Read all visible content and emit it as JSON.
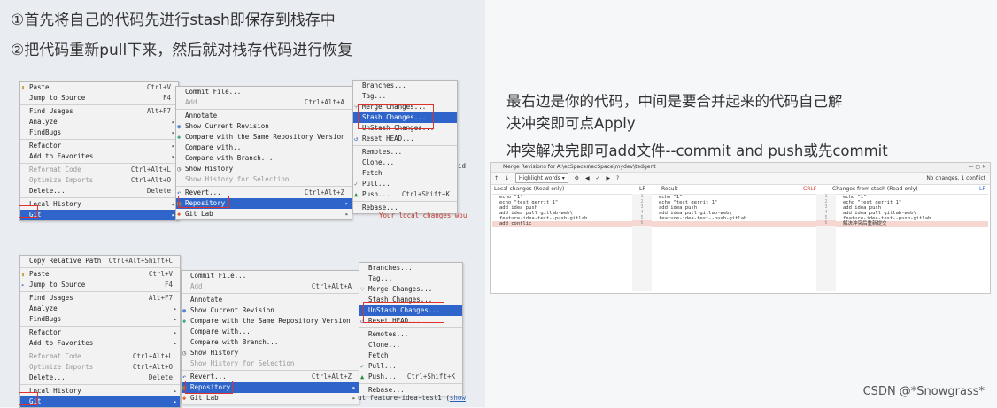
{
  "headings": {
    "step1": "①首先将自己的代码先进行stash即保存到栈存中",
    "step2": "②把代码重新pull下来，然后就对栈存代码进行恢复"
  },
  "notes": {
    "line1": "最右边是你的代码，中间是要合并起来的代码自己解",
    "line2": "决冲突即可点Apply",
    "line3": "冲突解决完即可add文件--commit and push或先commit"
  },
  "top_screenshot": {
    "menu1": {
      "items": [
        {
          "label": "Paste",
          "shortcut": "Ctrl+V"
        },
        {
          "label": "Jump to Source",
          "shortcut": "F4"
        },
        {
          "label": "Find Usages",
          "shortcut": "Alt+F7"
        },
        {
          "label": "Analyze",
          "shortcut": ""
        },
        {
          "label": "FindBugs",
          "shortcut": ""
        },
        {
          "label": "Refactor",
          "shortcut": ""
        },
        {
          "label": "Add to Favorites",
          "shortcut": ""
        },
        {
          "label": "Reformat Code",
          "shortcut": "Ctrl+Alt+L"
        },
        {
          "label": "Optimize Imports",
          "shortcut": "Ctrl+Alt+O"
        },
        {
          "label": "Delete...",
          "shortcut": "Delete"
        },
        {
          "label": "Local History",
          "shortcut": ""
        },
        {
          "label": "Git",
          "shortcut": ""
        }
      ]
    },
    "menu2": {
      "items": [
        {
          "label": "Commit File...",
          "shortcut": ""
        },
        {
          "label": "Add",
          "shortcut": "Ctrl+Alt+A"
        },
        {
          "label": "Annotate",
          "shortcut": ""
        },
        {
          "label": "Show Current Revision",
          "shortcut": ""
        },
        {
          "label": "Compare with the Same Repository Version",
          "shortcut": ""
        },
        {
          "label": "Compare with...",
          "shortcut": ""
        },
        {
          "label": "Compare with Branch...",
          "shortcut": ""
        },
        {
          "label": "Show History",
          "shortcut": ""
        },
        {
          "label": "Show History for Selection",
          "shortcut": ""
        },
        {
          "label": "Revert...",
          "shortcut": "Ctrl+Alt+Z"
        },
        {
          "label": "Repository",
          "shortcut": ""
        },
        {
          "label": "Git Lab",
          "shortcut": ""
        }
      ]
    },
    "menu3": {
      "items": [
        {
          "label": "Branches...",
          "shortcut": ""
        },
        {
          "label": "Tag...",
          "shortcut": ""
        },
        {
          "label": "Merge Changes...",
          "shortcut": ""
        },
        {
          "label": "Stash Changes...",
          "shortcut": ""
        },
        {
          "label": "UnStash Changes...",
          "shortcut": ""
        },
        {
          "label": "Reset HEAD...",
          "shortcut": ""
        },
        {
          "label": "Remotes...",
          "shortcut": ""
        },
        {
          "label": "Clone...",
          "shortcut": ""
        },
        {
          "label": "Fetch",
          "shortcut": ""
        },
        {
          "label": "Pull...",
          "shortcut": ""
        },
        {
          "label": "Push...",
          "shortcut": "Ctrl+Shift+K"
        },
        {
          "label": "Rebase...",
          "shortcut": ""
        }
      ]
    },
    "status_id": "id",
    "status_message": "Your local changes wou"
  },
  "bottom_screenshot": {
    "menu1": {
      "items": [
        {
          "label": "Copy Relative Path",
          "shortcut": "Ctrl+Alt+Shift+C"
        },
        {
          "label": "Paste",
          "shortcut": "Ctrl+V"
        },
        {
          "label": "Jump to Source",
          "shortcut": "F4"
        },
        {
          "label": "Find Usages",
          "shortcut": "Alt+F7"
        },
        {
          "label": "Analyze",
          "shortcut": ""
        },
        {
          "label": "FindBugs",
          "shortcut": ""
        },
        {
          "label": "Refactor",
          "shortcut": ""
        },
        {
          "label": "Add to Favorites",
          "shortcut": ""
        },
        {
          "label": "Reformat Code",
          "shortcut": "Ctrl+Alt+L"
        },
        {
          "label": "Optimize Imports",
          "shortcut": "Ctrl+Alt+O"
        },
        {
          "label": "Delete...",
          "shortcut": "Delete"
        },
        {
          "label": "Local History",
          "shortcut": ""
        },
        {
          "label": "Git",
          "shortcut": ""
        }
      ]
    },
    "menu2": {
      "items": [
        {
          "label": "Commit File...",
          "shortcut": ""
        },
        {
          "label": "Add",
          "shortcut": "Ctrl+Alt+A"
        },
        {
          "label": "Annotate",
          "shortcut": ""
        },
        {
          "label": "Show Current Revision",
          "shortcut": ""
        },
        {
          "label": "Compare with the Same Repository Version",
          "shortcut": ""
        },
        {
          "label": "Compare with...",
          "shortcut": ""
        },
        {
          "label": "Compare with Branch...",
          "shortcut": ""
        },
        {
          "label": "Show History",
          "shortcut": ""
        },
        {
          "label": "Show History for Selection",
          "shortcut": ""
        },
        {
          "label": "Revert...",
          "shortcut": "Ctrl+Alt+Z"
        },
        {
          "label": "Repository",
          "shortcut": ""
        },
        {
          "label": "Git Lab",
          "shortcut": ""
        }
      ]
    },
    "menu3": {
      "items": [
        {
          "label": "Branches...",
          "shortcut": ""
        },
        {
          "label": "Tag...",
          "shortcut": ""
        },
        {
          "label": "Merge Changes...",
          "shortcut": ""
        },
        {
          "label": "Stash Changes...",
          "shortcut": ""
        },
        {
          "label": "UnStash Changes...",
          "shortcut": ""
        },
        {
          "label": "Reset HEAD...",
          "shortcut": ""
        },
        {
          "label": "Remotes...",
          "shortcut": ""
        },
        {
          "label": "Clone...",
          "shortcut": ""
        },
        {
          "label": "Fetch",
          "shortcut": ""
        },
        {
          "label": "Pull...",
          "shortcut": ""
        },
        {
          "label": "Push...",
          "shortcut": "Ctrl+Shift+K"
        },
        {
          "label": "Rebase...",
          "shortcut": ""
        }
      ]
    },
    "status_message": "ut feature-idea-test1 (",
    "status_link": "show"
  },
  "merge_window": {
    "title": "Merge Revisions for A:\\ecSpaces\\ecSpace\\mydev\\tedgent",
    "toolbar": {
      "highlight_label": "Highlight words",
      "summary": "No changes. 1 conflict"
    },
    "left": {
      "header": "Local changes (Read-only)",
      "tag": "LF",
      "lines": [
        "echo \"1\"",
        "echo \"test gerrit 1\"",
        "add idea push",
        "add idea pull gitlab-web\\",
        "feature-idea-test--push-gitlab",
        "add conflic"
      ]
    },
    "center": {
      "header": "Result",
      "tag": "CRLF",
      "lines": [
        "echo \"1\"",
        "echo \"test gerrit 1\"",
        "add idea push",
        "add idea pull gitlab-web\\",
        "feature-idea-test--push-gitlab",
        ""
      ]
    },
    "right": {
      "header": "Changes from stash (Read-only)",
      "tag": "LF",
      "lines": [
        "echo \"1\"",
        "echo \"test gerrit 1\"",
        "add idea push",
        "add idea pull gitlab-web\\",
        "feature-idea-test--push-gitlab",
        "解决冲突后重新提交"
      ]
    }
  },
  "watermark": "CSDN @*Snowgrass*",
  "colors": {
    "menu_selection": "#2f65ca",
    "highlight_box": "#e0322c",
    "conflict_bg": "#f7d7d2"
  }
}
